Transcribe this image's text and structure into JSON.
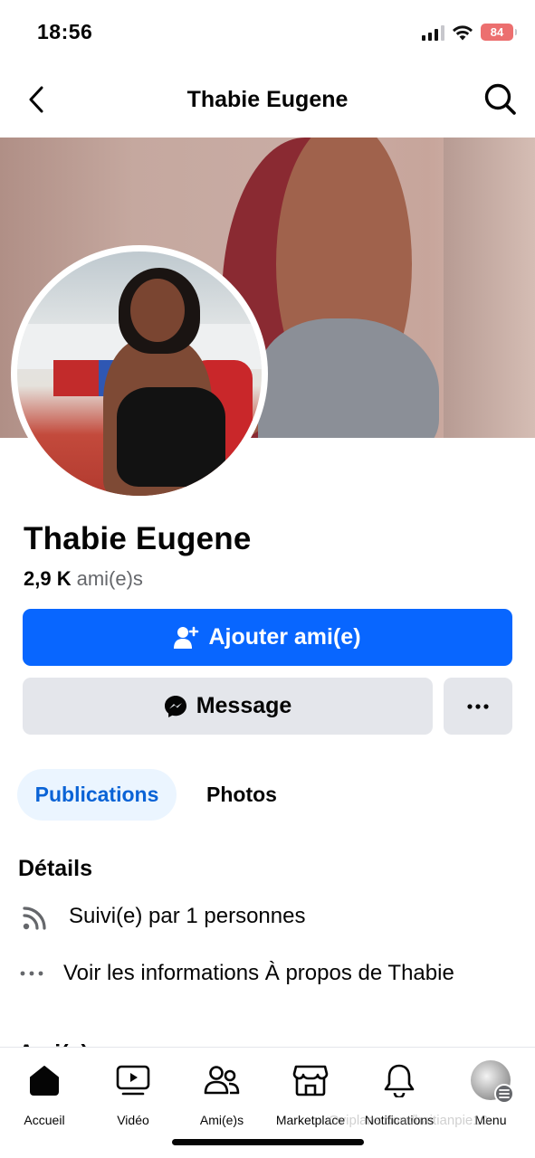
{
  "status_bar": {
    "time": "18:56",
    "battery": "84"
  },
  "header": {
    "title": "Thabie Eugene"
  },
  "profile": {
    "name": "Thabie Eugene",
    "friends_count": "2,9 K",
    "friends_label": "ami(e)s"
  },
  "actions": {
    "add_friend": "Ajouter ami(e)",
    "message": "Message"
  },
  "tabs": {
    "publications": "Publications",
    "photos": "Photos"
  },
  "details": {
    "title": "Détails",
    "followed_by": "Suivi(e) par 1 personnes",
    "about": "Voir les informations À propos de Thabie"
  },
  "next_section_title": "Ami(e)s",
  "bottom_nav": [
    {
      "label": "Accueil",
      "icon": "home-icon"
    },
    {
      "label": "Vidéo",
      "icon": "video-icon"
    },
    {
      "label": "Ami(e)s",
      "icon": "friends-icon"
    },
    {
      "label": "Marketplace",
      "icon": "marketplace-icon"
    },
    {
      "label": "Notifications",
      "icon": "bell-icon"
    },
    {
      "label": "Menu",
      "icon": "menu-avatar"
    }
  ],
  "watermark": "Oviplans.com/haitianpie10",
  "colors": {
    "primary": "#0866ff",
    "tab_active_bg": "#ebf5ff",
    "button_grey": "#e4e6eb"
  }
}
